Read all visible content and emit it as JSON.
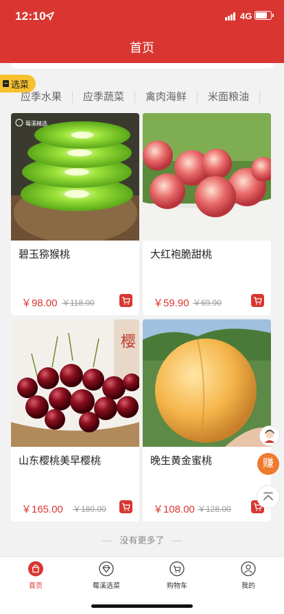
{
  "status_bar": {
    "time": "12:10",
    "network": "4G"
  },
  "nav": {
    "title": "首页"
  },
  "pick_badge": {
    "label": "选菜"
  },
  "categories": [
    "应季水果",
    "应季蔬菜",
    "禽肉海鲜",
    "米面粮油"
  ],
  "products": [
    {
      "name": "碧玉猕猴桃",
      "price": "￥98.00",
      "original_price": "￥118.00",
      "image_watermark": "莓溪精选"
    },
    {
      "name": "大红袍脆甜桃",
      "price": "￥59.90",
      "original_price": "￥69.90"
    },
    {
      "name": "山东樱桃美早樱桃",
      "price": "￥165.00",
      "original_price": "￥180.00",
      "image_sign": "樱"
    },
    {
      "name": "晚生黄金蜜桃",
      "price": "￥108.00",
      "original_price": "￥128.00"
    }
  ],
  "footer_note": "没有更多了",
  "floating": {
    "earn_label": "赚"
  },
  "tabs": [
    {
      "label": "首页",
      "icon": "shopping-bag-icon",
      "active": true
    },
    {
      "label": "莓溪选菜",
      "icon": "gem-icon",
      "active": false
    },
    {
      "label": "购物车",
      "icon": "cart-icon",
      "active": false
    },
    {
      "label": "我的",
      "icon": "user-icon",
      "active": false
    }
  ],
  "colors": {
    "brand_red": "#d93631",
    "badge_yellow": "#f6c12c",
    "earn_orange": "#ee7a2f"
  }
}
